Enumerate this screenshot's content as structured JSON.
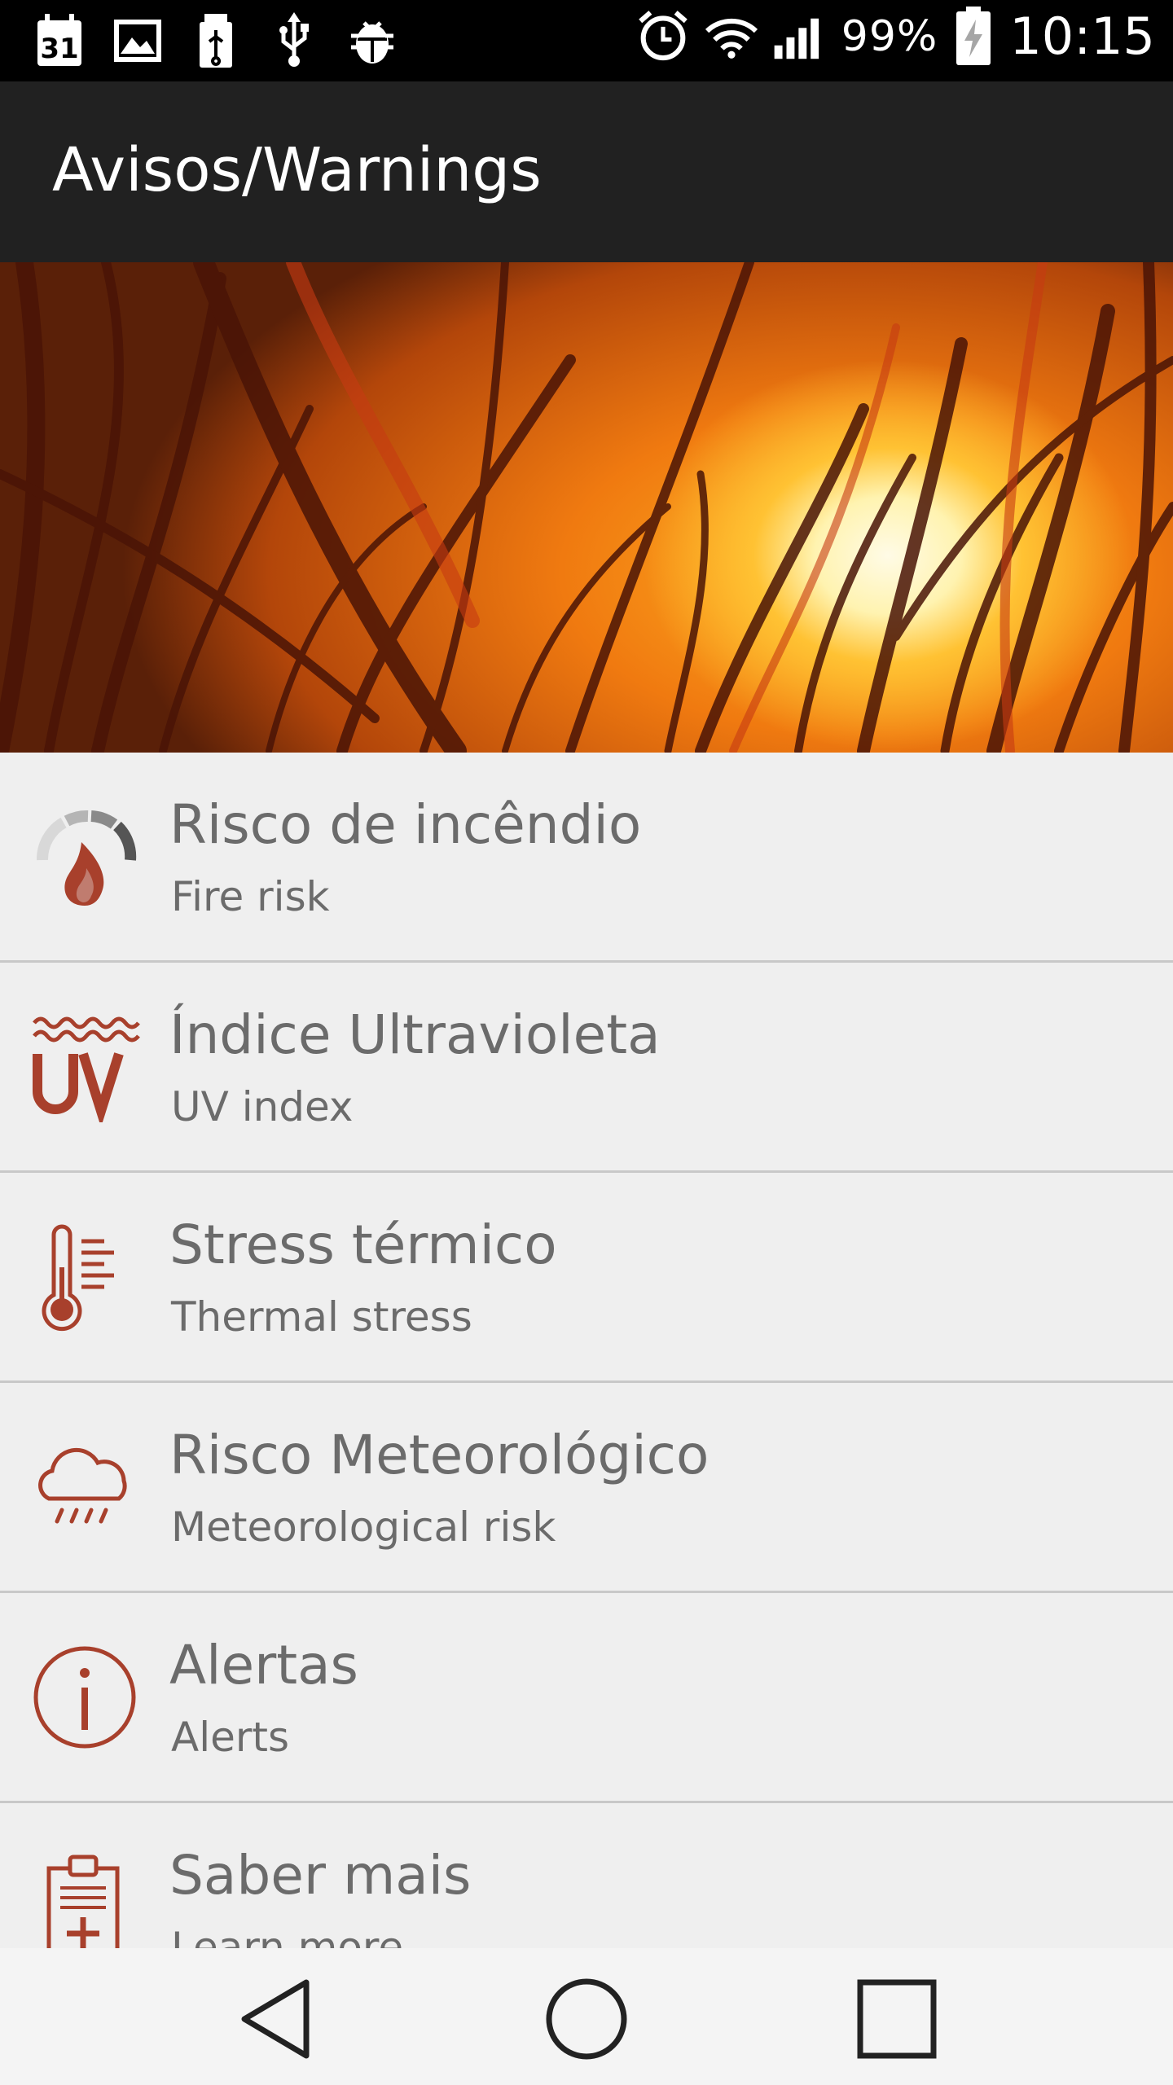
{
  "status_bar": {
    "left_icons": [
      "calendar-icon",
      "image-icon",
      "usb-storage-icon",
      "usb-icon",
      "android-debug-icon"
    ],
    "calendar_day": "31",
    "battery_percent": "99%",
    "time": "10:15",
    "right_icons": [
      "alarm-icon",
      "wifi-icon",
      "signal-icon",
      "battery-charging-icon"
    ]
  },
  "app_bar": {
    "title": "Avisos/Warnings"
  },
  "banner": {
    "image": "sunset-grass-banner"
  },
  "list": {
    "items": [
      {
        "title": "Risco de incêndio",
        "subtitle": "Fire risk",
        "icon": "fire-gauge-icon"
      },
      {
        "title": "Índice Ultravioleta",
        "subtitle": "UV index",
        "icon": "uv-icon"
      },
      {
        "title": "Stress térmico",
        "subtitle": "Thermal stress",
        "icon": "thermometer-icon"
      },
      {
        "title": "Risco Meteorológico",
        "subtitle": "Meteorological risk",
        "icon": "rain-cloud-icon"
      },
      {
        "title": "Alertas",
        "subtitle": "Alerts",
        "icon": "info-icon"
      },
      {
        "title": "Saber mais",
        "subtitle": "Learn more",
        "icon": "clipboard-icon"
      }
    ]
  },
  "nav_bar": {
    "buttons": [
      "back-button",
      "home-button",
      "recents-button"
    ]
  },
  "colors": {
    "status_bar_bg": "#000000",
    "app_bar_bg": "#212121",
    "list_bg": "#efefef",
    "icon_accent": "#a8402c",
    "text_gray": "#6b6b6b"
  }
}
